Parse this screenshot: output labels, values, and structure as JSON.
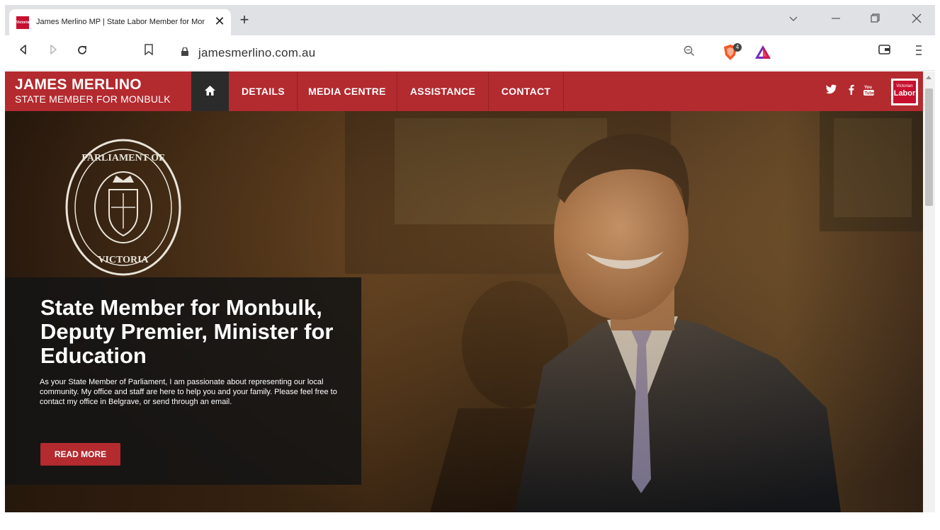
{
  "browser": {
    "tab_title": "James Merlino MP | State Labor Member for Monb",
    "favicon_text": "Victorian Labor",
    "url": "jamesmerlino.com.au",
    "shield_count": "4"
  },
  "site": {
    "brand_name": "JAMES MERLINO",
    "brand_subtitle": "STATE MEMBER FOR MONBULK",
    "nav": [
      {
        "label": "DETAILS"
      },
      {
        "label": "MEDIA CENTRE"
      },
      {
        "label": "ASSISTANCE"
      },
      {
        "label": "CONTACT"
      }
    ],
    "social": {
      "twitter": "𝕥",
      "facebook": "f",
      "youtube": "▶"
    },
    "labor_logo": {
      "top": "Victorian",
      "bottom": "Labor"
    }
  },
  "hero": {
    "seal_text_top": "PARLIAMENT OF",
    "seal_text_bottom": "VICTORIA",
    "title": "State Member for Monbulk, Deputy Premier, Minister for Education",
    "body": "As your State Member of Parliament, I am passionate about representing our local community. My office and staff are here to help you and your family. Please feel free to contact my office in Belgrave, or send through an email.",
    "button_label": "READ MORE"
  },
  "colors": {
    "brand_red": "#b32a2f",
    "nav_home_bg": "#2b2b2b",
    "tabstrip_bg": "#dfe1e5"
  }
}
